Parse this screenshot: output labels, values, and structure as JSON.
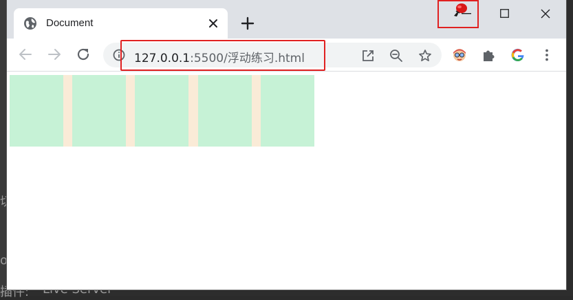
{
  "background_editor": {
    "fragments": [
      "切",
      "oc",
      "插件:",
      "Live Server"
    ]
  },
  "tab": {
    "title": "Document",
    "icon": "globe-icon",
    "close_icon": "close-icon"
  },
  "new_tab_icon": "plus-icon",
  "window_controls": [
    "minimize-icon",
    "maximize-icon",
    "close-icon"
  ],
  "extension_balloon_icon": "red-balloon-icon",
  "toolbar": {
    "back_icon": "arrow-left-icon",
    "forward_icon": "arrow-right-icon",
    "reload_icon": "reload-icon"
  },
  "omnibox": {
    "info_icon": "info-icon",
    "url_host": "127.0.0.1",
    "url_rest": ":5500/浮动练习.html",
    "icons": [
      "open-external-icon",
      "zoom-out-icon",
      "star-icon"
    ]
  },
  "extensions": [
    "avatar-extension-icon",
    "puzzle-icon",
    "google-icon",
    "more-vert-icon"
  ],
  "page": {
    "float_boxes": [
      {
        "color": "#c6f2d6"
      },
      {
        "color": "#c6f2d6"
      },
      {
        "color": "#c6f2d6"
      },
      {
        "color": "#c6f2d6"
      },
      {
        "color": "#c6f2d6"
      }
    ],
    "container_color": "#faebd7"
  },
  "colors": {
    "highlight": "#e02020",
    "titlebar": "#dee1e6"
  }
}
